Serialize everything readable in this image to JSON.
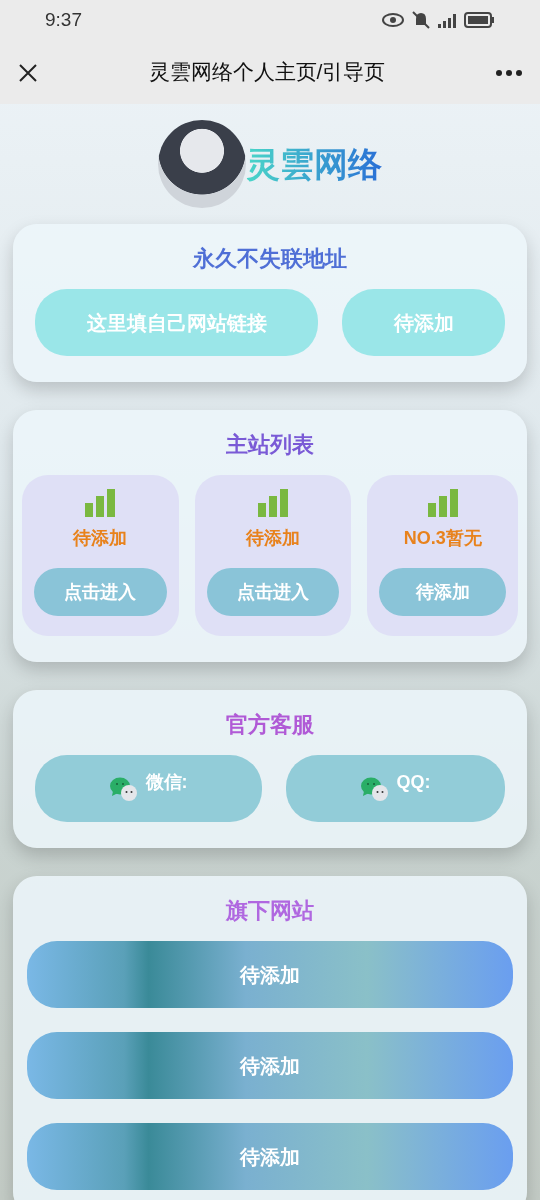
{
  "status_bar": {
    "time": "9:37"
  },
  "nav": {
    "title": "灵雲网络个人主页/引导页"
  },
  "header": {
    "logo_text": "灵雲网络"
  },
  "sections": [
    {
      "kind": "links",
      "title": "永久不失联地址",
      "buttons": [
        "这里填自己网站链接",
        "待添加"
      ]
    },
    {
      "kind": "sites",
      "title": "主站列表",
      "tiles": [
        {
          "name": "待添加",
          "button": "点击进入"
        },
        {
          "name": "待添加",
          "button": "点击进入"
        },
        {
          "name": "NO.3暂无",
          "button": "待添加"
        }
      ]
    },
    {
      "kind": "contacts",
      "title": "官方客服",
      "buttons": [
        "微信:",
        "QQ:"
      ]
    },
    {
      "kind": "list",
      "title": "旗下网站",
      "buttons": [
        "待添加",
        "待添加",
        "待添加"
      ]
    }
  ]
}
